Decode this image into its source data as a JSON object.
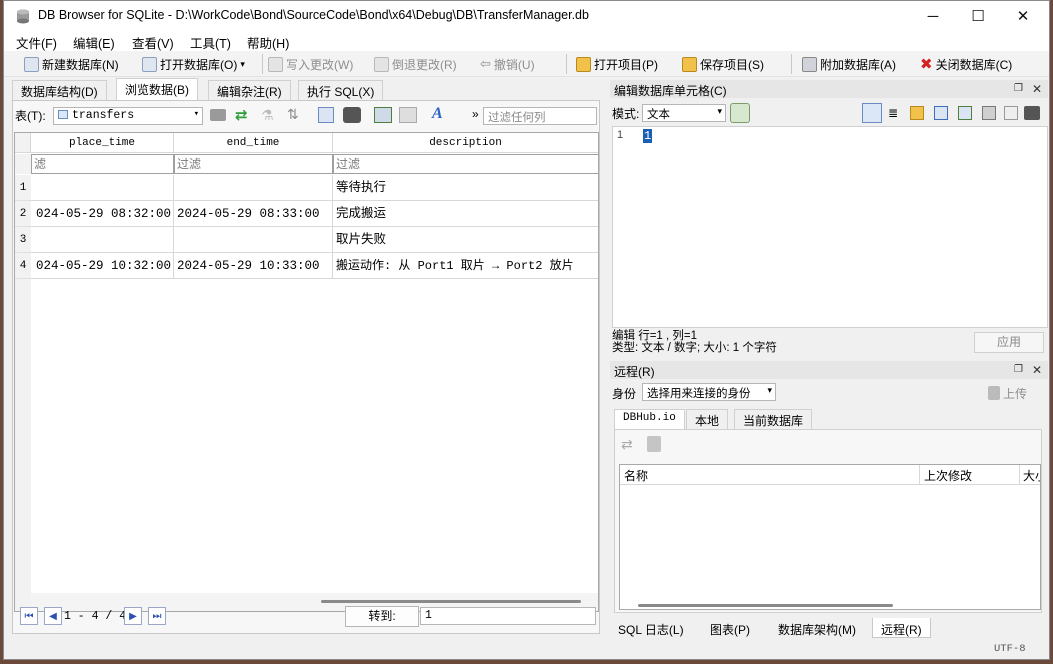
{
  "window": {
    "title": "DB Browser for SQLite - D:\\WorkCode\\Bond\\SourceCode\\Bond\\x64\\Debug\\DB\\TransferManager.db",
    "min": "─",
    "max": "☐",
    "close": "✕"
  },
  "menu": [
    "文件(F)",
    "编辑(E)",
    "查看(V)",
    "工具(T)",
    "帮助(H)"
  ],
  "toolbar": {
    "new_db": "新建数据库(N)",
    "open_db": "打开数据库(O)",
    "write": "写入更改(W)",
    "revert": "倒退更改(R)",
    "undo": "撤销(U)",
    "open_project": "打开项目(P)",
    "save_project": "保存项目(S)",
    "attach_db": "附加数据库(A)",
    "close_db": "关闭数据库(C)"
  },
  "tabs": [
    "数据库结构(D)",
    "浏览数据(B)",
    "编辑杂注(R)",
    "执行 SQL(X)"
  ],
  "browse": {
    "table_label": "表(T):",
    "table_value": "transfers",
    "filter_any_placeholder": "过滤任何列",
    "columns": [
      "place_time",
      "end_time",
      "description"
    ],
    "filter_placeholder": "过滤",
    "filter_first": "滤",
    "rows": [
      {
        "n": "1",
        "place_time": "",
        "end_time": "",
        "description": "等待执行"
      },
      {
        "n": "2",
        "place_time": "024-05-29 08:32:00",
        "end_time": "2024-05-29 08:33:00",
        "description": "完成搬运"
      },
      {
        "n": "3",
        "place_time": "",
        "end_time": "",
        "description": "取片失败"
      },
      {
        "n": "4",
        "place_time": "024-05-29 10:32:00",
        "end_time": "2024-05-29 10:33:00",
        "description": "搬运动作: 从 Port1 取片 → Port2 放片"
      }
    ],
    "range": "1 - 4 / 4",
    "goto_label": "转到:",
    "goto_value": "1"
  },
  "edit_cell": {
    "title": "编辑数据库单元格(C)",
    "mode_label": "模式:",
    "mode_value": "文本",
    "line_no": "1",
    "content": "1",
    "status1": "编辑 行=1 , 列=1",
    "status2": "类型: 文本 / 数字; 大小: 1 个字符",
    "apply": "应用"
  },
  "remote": {
    "title": "远程(R)",
    "identity_label": "身份",
    "identity_value": "选择用来连接的身份",
    "upload": "上传",
    "tabs": [
      "DBHub.io",
      "本地",
      "当前数据库"
    ],
    "columns": [
      "名称",
      "上次修改",
      "大小"
    ]
  },
  "bottom_tabs": [
    "SQL 日志(L)",
    "图表(P)",
    "数据库架构(M)",
    "远程(R)"
  ],
  "encoding": "UTF-8"
}
